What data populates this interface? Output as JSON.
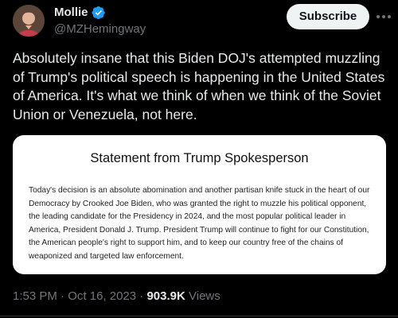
{
  "author": {
    "display_name": "Mollie",
    "handle": "@MZHemingway",
    "verified": true,
    "avatar_icon": "profile-photo"
  },
  "actions": {
    "subscribe_label": "Subscribe",
    "more_icon": "more-icon"
  },
  "tweet": {
    "text": "Absolutely insane that this Biden DOJ's attempted muzzling of Trump's political speech is happening in the United States of America. It's what we think of when we think of the Soviet Union or Venezuela, not here."
  },
  "media": {
    "title": "Statement from Trump Spokesperson",
    "body": "Today's decision is an absolute abomination and another partisan knife stuck in the heart of our Democracy by Crooked Joe Biden, who was granted the right to muzzle his political opponent, the leading candidate for the Presidency in 2024, and the most popular political leader in America, President Donald J. Trump. President Trump will continue to fight for our Constitution, the American people's right to support him, and to keep our country free of the chains of weaponized and targeted law enforcement."
  },
  "meta": {
    "time": "1:53 PM",
    "separator": " · ",
    "date": "Oct 16, 2023",
    "views_count": "903.9K",
    "views_label": " Views"
  },
  "colors": {
    "background": "#000000",
    "text_primary": "#e7e9ea",
    "text_secondary": "#71767b",
    "verified_blue": "#1d9bf0",
    "button_bg": "#eff3f4"
  }
}
